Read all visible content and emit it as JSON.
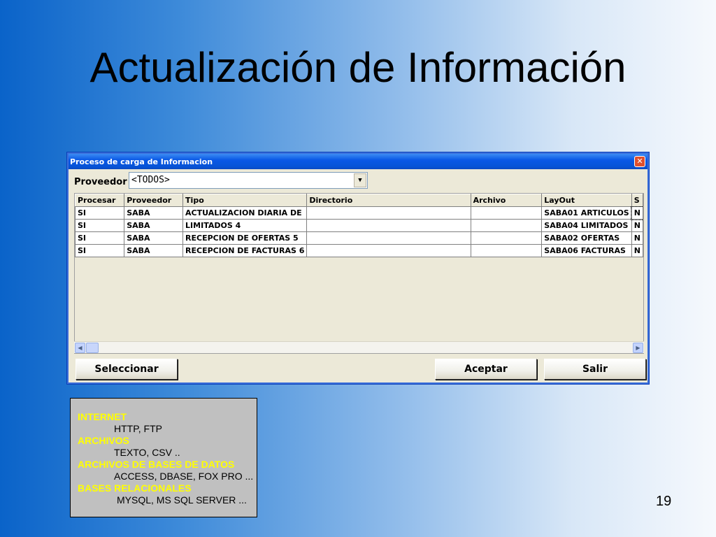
{
  "slide": {
    "title": "Actualización de Información",
    "page_number": "19"
  },
  "window": {
    "title": "Proceso de carga de Informacion",
    "close_glyph": "✕",
    "proveedor_label": "Proveedor",
    "proveedor_value": "<TODOS>",
    "grid": {
      "columns": [
        "Procesar",
        "Proveedor",
        "Tipo",
        "Directorio",
        "Archivo",
        "LayOut",
        "S"
      ],
      "rows": [
        [
          "SI",
          "SABA",
          "ACTUALIZACION DIARIA DE",
          "",
          "",
          "SABA01 ARTICULOS",
          "N"
        ],
        [
          "SI",
          "SABA",
          "LIMITADOS 4",
          "",
          "",
          "SABA04 LIMITADOS",
          "N"
        ],
        [
          "SI",
          "SABA",
          "RECEPCION DE OFERTAS 5",
          "",
          "",
          "SABA02 OFERTAS",
          "N"
        ],
        [
          "SI",
          "SABA",
          "RECEPCION DE FACTURAS 6",
          "",
          "",
          "SABA06 FACTURAS",
          "N"
        ]
      ]
    },
    "buttons": {
      "seleccionar": "Seleccionar",
      "aceptar": "Aceptar",
      "salir": "Salir"
    }
  },
  "info_box": {
    "sections": [
      {
        "category": "INTERNET",
        "detail": "HTTP, FTP"
      },
      {
        "category": "ARCHIVOS",
        "detail": "TEXTO, CSV .."
      },
      {
        "category": "ARCHIVOS DE BASES DE DATOS",
        "detail": "ACCESS, DBASE, FOX PRO ..."
      },
      {
        "category": "BASES RELACIONALES",
        "detail": "MYSQL, MS SQL SERVER ..."
      }
    ]
  },
  "colors": {
    "category_text": "#ffff00",
    "titlebar": "#0654d8"
  },
  "icons": {
    "close": "close-icon",
    "dropdown": "chevron-down-icon",
    "scroll_left": "arrow-left-icon",
    "scroll_right": "arrow-right-icon"
  }
}
